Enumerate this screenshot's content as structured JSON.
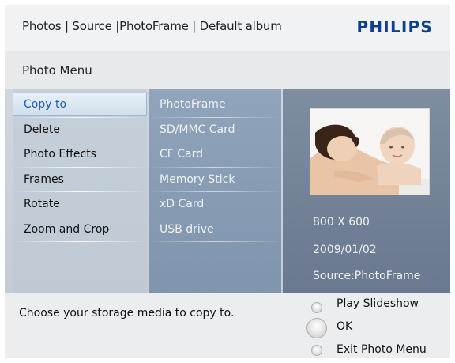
{
  "header": {
    "breadcrumb": "Photos | Source |PhotoFrame | Default album",
    "brand": "PHILIPS",
    "brand_color": "#0b3f8f"
  },
  "menu_title": "Photo Menu",
  "photo_menu": {
    "items": [
      {
        "label": "Copy to",
        "selected": true
      },
      {
        "label": "Delete"
      },
      {
        "label": "Photo Effects"
      },
      {
        "label": "Frames"
      },
      {
        "label": "Rotate"
      },
      {
        "label": "Zoom and Crop"
      }
    ]
  },
  "copy_targets": {
    "items": [
      {
        "label": "PhotoFrame"
      },
      {
        "label": "SD/MMC Card"
      },
      {
        "label": "CF Card"
      },
      {
        "label": "Memory Stick"
      },
      {
        "label": "xD Card"
      },
      {
        "label": "USB drive"
      }
    ]
  },
  "photo_info": {
    "resolution": "800 X 600",
    "date": "2009/01/02",
    "source": "Source:PhotoFrame"
  },
  "footer": {
    "hint": "Choose your storage media to copy to.",
    "nav": [
      {
        "label": "Play Slideshow",
        "icon": "radio-button-icon"
      },
      {
        "label": "OK",
        "icon": "ok-button-icon"
      },
      {
        "label": "Exit Photo Menu",
        "icon": "radio-button-icon"
      }
    ]
  }
}
